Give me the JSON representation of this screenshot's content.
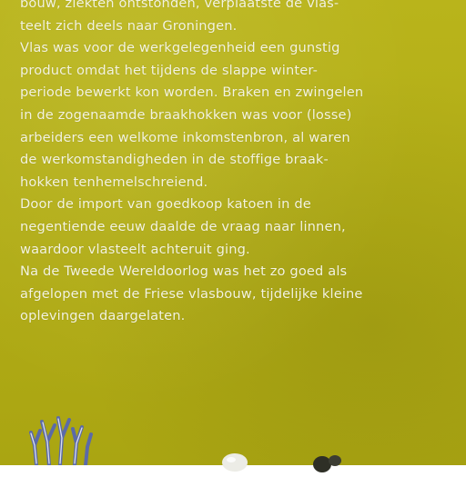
{
  "page": {
    "lines": [
      "bouw, ziekten ontstonden, verplaatste de vlas-",
      "teelt zich deels naar Groningen.",
      "Vlas was voor de werkgelegenheid een gunstig",
      "product omdat het tijdens de slappe winter-",
      "periode bewerkt kon worden. Braken en zwingelen",
      "in de zogenaamde braakhokken was voor (losse)",
      "arbeiders een welkome inkomstenbron, al waren",
      "de werkomstandigheden in de stoffige braak-",
      "hokken tenhemelschreiend.",
      "Door de import van goedkoop katoen in de",
      "negentiende eeuw daalde de vraag naar linnen,",
      "waardoor vlasteelt achteruit ging.",
      "Na de Tweede Wereldoorlog was het zo goed als",
      "afgelopen met de Friese vlasbouw, tijdelijke kleine",
      "oplevingen daargelaten."
    ]
  },
  "colors": {
    "background": "#b2ad16",
    "text": "#f3f3df",
    "illustration": "#5b6aa8"
  }
}
